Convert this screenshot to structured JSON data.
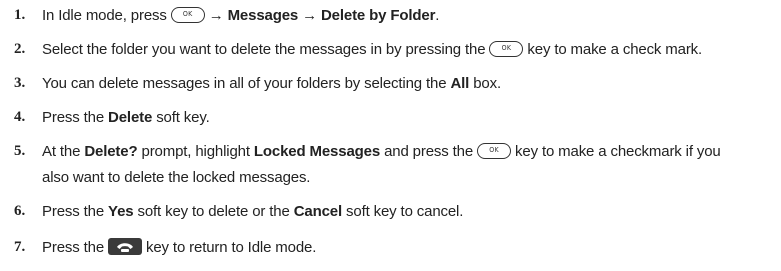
{
  "keys": {
    "ok_label": "OK",
    "end_icon": "end-call-phone-icon"
  },
  "steps": [
    {
      "num": "1.",
      "parts": {
        "a": "In Idle mode, press",
        "b": "→ Messages → Delete by Folder",
        "c": "."
      }
    },
    {
      "num": "2.",
      "parts": {
        "a": "Select the folder you want to delete the messages in by pressing the",
        "b": "key to make a check mark."
      }
    },
    {
      "num": "3.",
      "parts": {
        "a": "You can delete messages in all of your folders by selecting the",
        "b": "All",
        "c": "box."
      }
    },
    {
      "num": "4.",
      "parts": {
        "a": "Press the",
        "b": "Delete",
        "c": "soft key."
      }
    },
    {
      "num": "5.",
      "parts": {
        "a": "At the",
        "b": "Delete?",
        "c": "prompt, highlight",
        "d": "Locked Messages",
        "e": "and press the",
        "f": "key to make a checkmark if you",
        "g": "also want to delete the locked messages."
      }
    },
    {
      "num": "6.",
      "parts": {
        "a": "Press the",
        "b": "Yes",
        "c": "soft key to delete or the",
        "d": "Cancel",
        "e": "soft key to cancel."
      }
    },
    {
      "num": "7.",
      "parts": {
        "a": "Press the",
        "b": "key to return to Idle mode."
      }
    }
  ]
}
